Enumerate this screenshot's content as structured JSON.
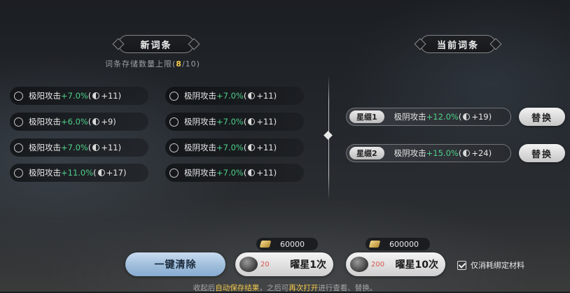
{
  "new_panel": {
    "title": "新词条",
    "capacity_prefix": "词条存储数量上限(",
    "capacity_current": "8",
    "capacity_suffix": "/10)",
    "options": [
      {
        "name": "极阳攻击",
        "pct": "+7.0%",
        "open": "(",
        "bonus": "+11)"
      },
      {
        "name": "极阴攻击",
        "pct": "+7.0%",
        "open": "(",
        "bonus": "+11)"
      },
      {
        "name": "极阳攻击",
        "pct": "+6.0%",
        "open": "(",
        "bonus": "+9)"
      },
      {
        "name": "极阴攻击",
        "pct": "+7.0%",
        "open": "(",
        "bonus": "+11)"
      },
      {
        "name": "极阳攻击",
        "pct": "+7.0%",
        "open": "(",
        "bonus": "+11)"
      },
      {
        "name": "极阴攻击",
        "pct": "+7.0%",
        "open": "(",
        "bonus": "+11)"
      },
      {
        "name": "极阳攻击",
        "pct": "+11.0%",
        "open": "(",
        "bonus": "+17)"
      },
      {
        "name": "极阴攻击",
        "pct": "+7.0%",
        "open": "(",
        "bonus": "+11)"
      }
    ]
  },
  "current_panel": {
    "title": "当前词条",
    "affixes": [
      {
        "tag": "星缀1",
        "name": "极阴攻击",
        "pct": "+12.0%",
        "open": "(",
        "bonus": "+19)",
        "button": "替换"
      },
      {
        "tag": "星缀2",
        "name": "极阴攻击",
        "pct": "+15.0%",
        "open": "(",
        "bonus": "+24)",
        "button": "替换"
      }
    ]
  },
  "bottom": {
    "clear_button": "一键清除",
    "star_once": {
      "cost": "60000",
      "ore": "20",
      "label": "曜星1次"
    },
    "star_ten": {
      "cost": "600000",
      "ore": "200",
      "label": "曜星10次"
    },
    "bound_only_label": "仅消耗绑定材料",
    "hint_parts": [
      "收起后",
      "自动保存结果",
      "，之后可",
      "再次打开",
      "进行查看、替换。"
    ]
  },
  "colors": {
    "bonus_green": "#4fd08a",
    "highlight_yellow": "#f2c94c",
    "cost_red": "#d9534f"
  }
}
